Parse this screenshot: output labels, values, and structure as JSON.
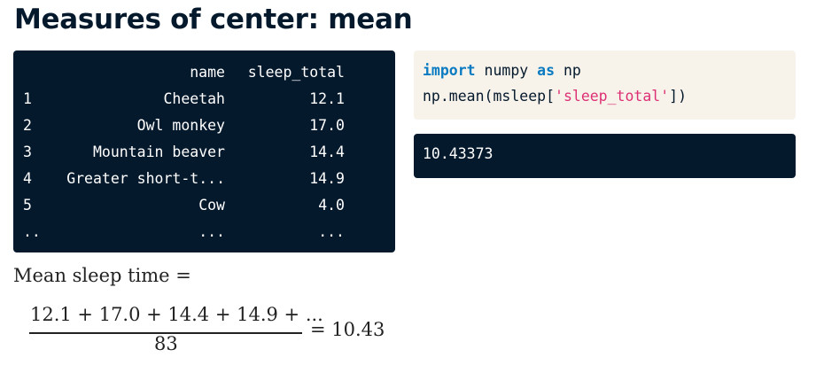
{
  "slide": {
    "title": "Measures of center: mean"
  },
  "dataframe": {
    "columns": [
      "name",
      "sleep_total"
    ],
    "rows": [
      {
        "index": "1",
        "name": "Cheetah",
        "sleep_total": "12.1"
      },
      {
        "index": "2",
        "name": "Owl monkey",
        "sleep_total": "17.0"
      },
      {
        "index": "3",
        "name": "Mountain beaver",
        "sleep_total": "14.4"
      },
      {
        "index": "4",
        "name": "Greater short-t...",
        "sleep_total": "14.9"
      },
      {
        "index": "5",
        "name": "Cow",
        "sleep_total": "4.0"
      },
      {
        "index": "..",
        "name": "...",
        "sleep_total": "..."
      }
    ]
  },
  "code": {
    "line1": {
      "kw_import": "import",
      "module": " numpy ",
      "kw_as": "as",
      "alias": " np"
    },
    "line2": {
      "prefix": "np.mean(msleep[",
      "string": "'sleep_total'",
      "suffix": "])"
    }
  },
  "output": {
    "text": "10.43373"
  },
  "formula": {
    "label": "Mean sleep time =",
    "numerator": "12.1 + 17.0 + 14.4 + 14.9 + ...",
    "denominator": "83",
    "result": "= 10.43"
  },
  "colors": {
    "dark_panel": "#05192d",
    "code_background": "#f7f3eb",
    "keyword": "#0b7bc1",
    "string": "#dd3074"
  }
}
